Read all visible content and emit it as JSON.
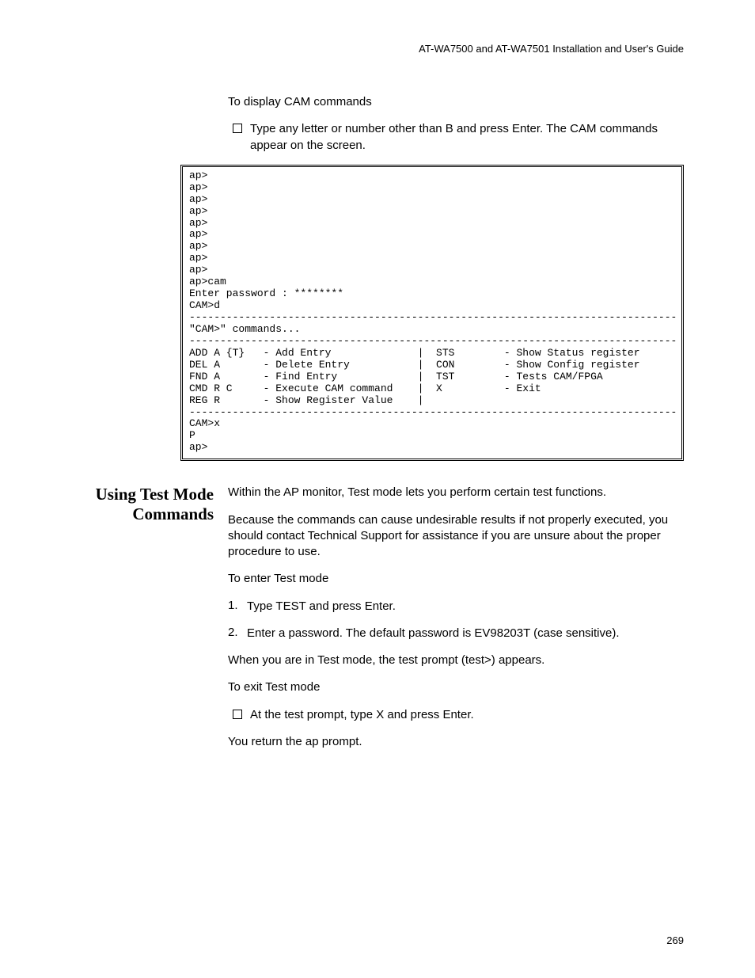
{
  "runningHead": "AT-WA7500 and AT-WA7501 Installation and User's Guide",
  "section1": {
    "intro": "To display CAM commands",
    "bullet": "Type any letter or number other than B and press Enter. The CAM commands appear on the screen."
  },
  "terminal": "ap>\nap>\nap>\nap>\nap>\nap>\nap>\nap>\nap>\nap>cam\nEnter password : ********\nCAM>d\n-------------------------------------------------------------------------------\n\"CAM>\" commands...\n-------------------------------------------------------------------------------\nADD A {T}   - Add Entry              |  STS        - Show Status register\nDEL A       - Delete Entry           |  CON        - Show Config register\nFND A       - Find Entry             |  TST        - Tests CAM/FPGA\nCMD R C     - Execute CAM command    |  X          - Exit\nREG R       - Show Register Value    |\n-------------------------------------------------------------------------------\nCAM>x\nP\nap>",
  "section2": {
    "heading": "Using Test Mode Commands",
    "p1": "Within the AP monitor, Test mode lets you perform certain test functions.",
    "p2": "Because the commands can cause undesirable results if not properly executed, you should contact Technical Support for assistance if you are unsure about the proper procedure to use.",
    "p3": "To enter Test mode",
    "step1": "Type TEST and press Enter.",
    "step2": "Enter a password. The default password is EV98203T (case sensitive).",
    "p4": "When you are in Test mode, the test prompt (test>) appears.",
    "p5": "To exit Test mode",
    "bullet": "At the test prompt, type X and press Enter.",
    "p6": "You return the ap prompt."
  },
  "pageNumber": "269"
}
